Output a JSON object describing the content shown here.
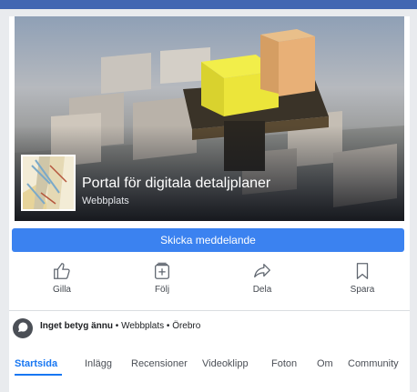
{
  "page": {
    "title": "Portal för digitala detaljplaner",
    "category": "Webbplats"
  },
  "send_message": {
    "label": "Skicka meddelande"
  },
  "actions": [
    {
      "label": "Gilla",
      "icon": "thumbs-up-icon"
    },
    {
      "label": "Följ",
      "icon": "follow-icon"
    },
    {
      "label": "Dela",
      "icon": "share-icon"
    },
    {
      "label": "Spara",
      "icon": "bookmark-icon"
    }
  ],
  "info": {
    "rating": "Inget betyg ännu",
    "type": "Webbplats",
    "location": "Örebro",
    "separator": " • "
  },
  "tabs": [
    {
      "label": "Startsida",
      "active": true
    },
    {
      "label": "Inlägg"
    },
    {
      "label": "Recensioner"
    },
    {
      "label": "Videoklipp"
    },
    {
      "label": "Foton"
    },
    {
      "label": "Om"
    },
    {
      "label": "Community"
    }
  ],
  "colors": {
    "accent": "#1877f2",
    "button": "#3b82f0",
    "header": "#4267b2"
  }
}
